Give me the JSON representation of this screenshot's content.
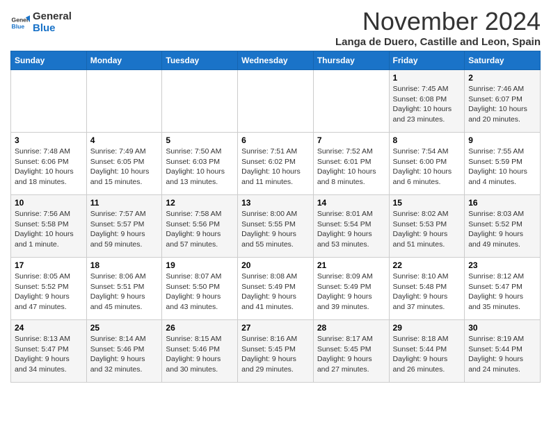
{
  "header": {
    "logo_line1": "General",
    "logo_line2": "Blue",
    "month": "November 2024",
    "location": "Langa de Duero, Castille and Leon, Spain"
  },
  "weekdays": [
    "Sunday",
    "Monday",
    "Tuesday",
    "Wednesday",
    "Thursday",
    "Friday",
    "Saturday"
  ],
  "weeks": [
    [
      {
        "day": "",
        "content": ""
      },
      {
        "day": "",
        "content": ""
      },
      {
        "day": "",
        "content": ""
      },
      {
        "day": "",
        "content": ""
      },
      {
        "day": "",
        "content": ""
      },
      {
        "day": "1",
        "content": "Sunrise: 7:45 AM\nSunset: 6:08 PM\nDaylight: 10 hours\nand 23 minutes."
      },
      {
        "day": "2",
        "content": "Sunrise: 7:46 AM\nSunset: 6:07 PM\nDaylight: 10 hours\nand 20 minutes."
      }
    ],
    [
      {
        "day": "3",
        "content": "Sunrise: 7:48 AM\nSunset: 6:06 PM\nDaylight: 10 hours\nand 18 minutes."
      },
      {
        "day": "4",
        "content": "Sunrise: 7:49 AM\nSunset: 6:05 PM\nDaylight: 10 hours\nand 15 minutes."
      },
      {
        "day": "5",
        "content": "Sunrise: 7:50 AM\nSunset: 6:03 PM\nDaylight: 10 hours\nand 13 minutes."
      },
      {
        "day": "6",
        "content": "Sunrise: 7:51 AM\nSunset: 6:02 PM\nDaylight: 10 hours\nand 11 minutes."
      },
      {
        "day": "7",
        "content": "Sunrise: 7:52 AM\nSunset: 6:01 PM\nDaylight: 10 hours\nand 8 minutes."
      },
      {
        "day": "8",
        "content": "Sunrise: 7:54 AM\nSunset: 6:00 PM\nDaylight: 10 hours\nand 6 minutes."
      },
      {
        "day": "9",
        "content": "Sunrise: 7:55 AM\nSunset: 5:59 PM\nDaylight: 10 hours\nand 4 minutes."
      }
    ],
    [
      {
        "day": "10",
        "content": "Sunrise: 7:56 AM\nSunset: 5:58 PM\nDaylight: 10 hours\nand 1 minute."
      },
      {
        "day": "11",
        "content": "Sunrise: 7:57 AM\nSunset: 5:57 PM\nDaylight: 9 hours\nand 59 minutes."
      },
      {
        "day": "12",
        "content": "Sunrise: 7:58 AM\nSunset: 5:56 PM\nDaylight: 9 hours\nand 57 minutes."
      },
      {
        "day": "13",
        "content": "Sunrise: 8:00 AM\nSunset: 5:55 PM\nDaylight: 9 hours\nand 55 minutes."
      },
      {
        "day": "14",
        "content": "Sunrise: 8:01 AM\nSunset: 5:54 PM\nDaylight: 9 hours\nand 53 minutes."
      },
      {
        "day": "15",
        "content": "Sunrise: 8:02 AM\nSunset: 5:53 PM\nDaylight: 9 hours\nand 51 minutes."
      },
      {
        "day": "16",
        "content": "Sunrise: 8:03 AM\nSunset: 5:52 PM\nDaylight: 9 hours\nand 49 minutes."
      }
    ],
    [
      {
        "day": "17",
        "content": "Sunrise: 8:05 AM\nSunset: 5:52 PM\nDaylight: 9 hours\nand 47 minutes."
      },
      {
        "day": "18",
        "content": "Sunrise: 8:06 AM\nSunset: 5:51 PM\nDaylight: 9 hours\nand 45 minutes."
      },
      {
        "day": "19",
        "content": "Sunrise: 8:07 AM\nSunset: 5:50 PM\nDaylight: 9 hours\nand 43 minutes."
      },
      {
        "day": "20",
        "content": "Sunrise: 8:08 AM\nSunset: 5:49 PM\nDaylight: 9 hours\nand 41 minutes."
      },
      {
        "day": "21",
        "content": "Sunrise: 8:09 AM\nSunset: 5:49 PM\nDaylight: 9 hours\nand 39 minutes."
      },
      {
        "day": "22",
        "content": "Sunrise: 8:10 AM\nSunset: 5:48 PM\nDaylight: 9 hours\nand 37 minutes."
      },
      {
        "day": "23",
        "content": "Sunrise: 8:12 AM\nSunset: 5:47 PM\nDaylight: 9 hours\nand 35 minutes."
      }
    ],
    [
      {
        "day": "24",
        "content": "Sunrise: 8:13 AM\nSunset: 5:47 PM\nDaylight: 9 hours\nand 34 minutes."
      },
      {
        "day": "25",
        "content": "Sunrise: 8:14 AM\nSunset: 5:46 PM\nDaylight: 9 hours\nand 32 minutes."
      },
      {
        "day": "26",
        "content": "Sunrise: 8:15 AM\nSunset: 5:46 PM\nDaylight: 9 hours\nand 30 minutes."
      },
      {
        "day": "27",
        "content": "Sunrise: 8:16 AM\nSunset: 5:45 PM\nDaylight: 9 hours\nand 29 minutes."
      },
      {
        "day": "28",
        "content": "Sunrise: 8:17 AM\nSunset: 5:45 PM\nDaylight: 9 hours\nand 27 minutes."
      },
      {
        "day": "29",
        "content": "Sunrise: 8:18 AM\nSunset: 5:44 PM\nDaylight: 9 hours\nand 26 minutes."
      },
      {
        "day": "30",
        "content": "Sunrise: 8:19 AM\nSunset: 5:44 PM\nDaylight: 9 hours\nand 24 minutes."
      }
    ]
  ]
}
